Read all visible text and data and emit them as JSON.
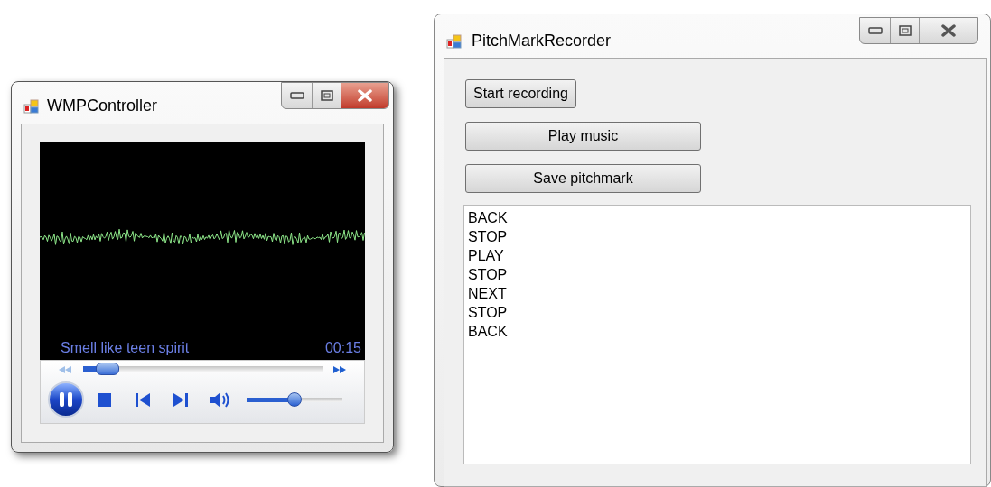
{
  "player_window": {
    "title": "WMPController",
    "active": true,
    "track_title": "Smell like teen spirit",
    "time": "00:15",
    "playing": true,
    "seek": {
      "level": 0.1
    },
    "volume": {
      "level": 0.5
    }
  },
  "recorder_window": {
    "title": "PitchMarkRecorder",
    "active": false,
    "buttons": [
      {
        "label": "Start recording",
        "wide": false
      },
      {
        "label": "Play music",
        "wide": true
      },
      {
        "label": "Save pitchmark",
        "wide": true
      }
    ],
    "log_lines": [
      "BACK",
      "STOP",
      "PLAY",
      "STOP",
      "NEXT",
      "STOP",
      "BACK"
    ]
  }
}
